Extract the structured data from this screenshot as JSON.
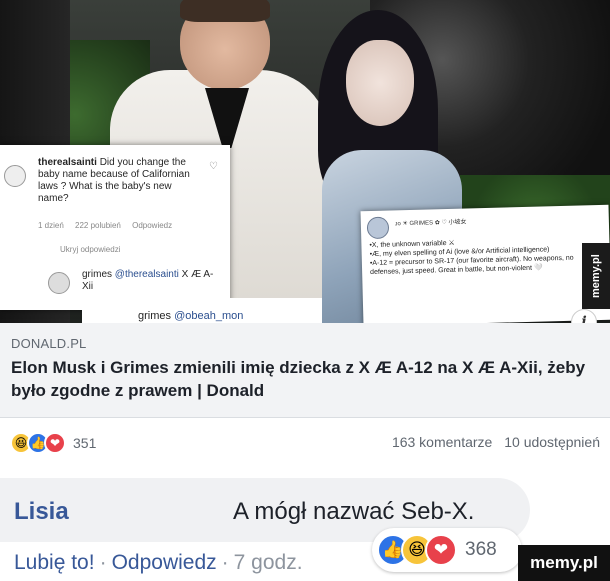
{
  "photo": {
    "ig_comment": {
      "username": "therealsainti",
      "text": "Did you change the baby name because of Californian laws ? What is the baby's new name?",
      "meta": [
        "1 dzień",
        "222 polubień",
        "Odpowiedz"
      ],
      "hidden_replies": "Ukryj odpowiedzi",
      "reply_user": "grimes",
      "reply_mention": "@therealsainti",
      "reply_text": "X Æ A-Xii"
    },
    "ig_comment_2": {
      "user": "grimes",
      "mention": "@obeah_mon"
    },
    "tweet": {
      "name": "ᴊᴏ ☀︎ GRIMES ✿ ♡ 小坡女",
      "lines": [
        "•X, the unknown variable ⚔",
        "•Æ, my elven spelling of Ai (love &/or Artificial intelligence)",
        "•A-12 = precursor to SR-17 (our favorite aircraft). No weapons, no defenses, just speed. Great in battle, but non-violent 🤍"
      ]
    },
    "side_watermark": "memy.pl"
  },
  "link": {
    "domain": "DONALD.PL",
    "headline": "Elon Musk i Grimes zmienili imię dziecka z X Æ A-12 na X Æ A-Xii, żeby było zgodne z prawem | Donald"
  },
  "reactions": {
    "count": "351",
    "comments": "163 komentarze",
    "shares": "10 udostępnień"
  },
  "comment": {
    "author": "Lisia",
    "text": "A mógł nazwać Seb-X.",
    "like": "Lubię to!",
    "reply": "Odpowiedz",
    "time": "7 godz.",
    "reaction_count": "368"
  },
  "watermark": "memy.pl",
  "colors": {
    "link_blue": "#385898",
    "like_blue": "#2d73e6",
    "love_red": "#e8414b",
    "haha_yellow": "#f7c43a"
  }
}
